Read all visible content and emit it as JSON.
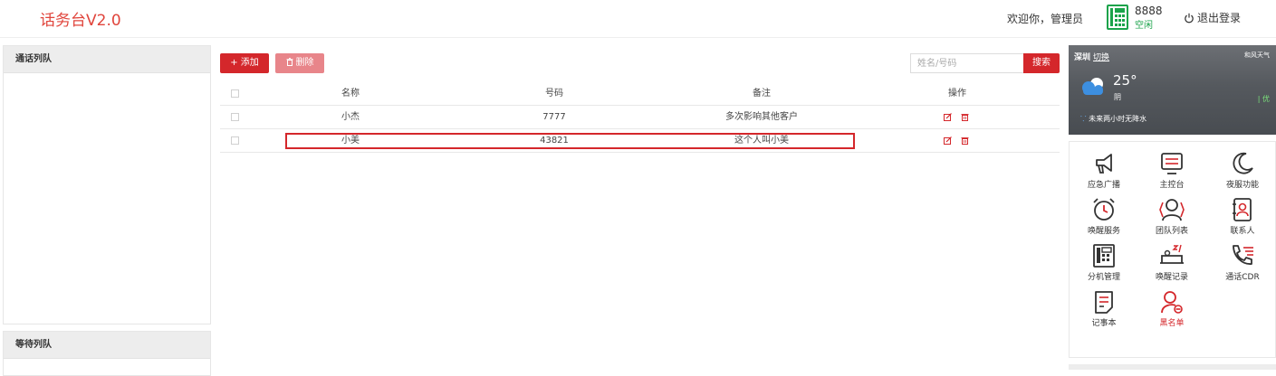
{
  "app": {
    "title": "话务台V2.0"
  },
  "header": {
    "welcome": "欢迎你，管理员",
    "extension": "8888",
    "extension_status": "空闲",
    "logout": "退出登录"
  },
  "left": {
    "call_queue_title": "通话列队",
    "wait_queue_title": "等待列队"
  },
  "toolbar": {
    "add_label": "+ 添加",
    "delete_label": "删除",
    "search_placeholder": "姓名/号码",
    "search_label": "搜索"
  },
  "table": {
    "columns": [
      "名称",
      "号码",
      "备注",
      "操作"
    ],
    "rows": [
      {
        "name": "小杰",
        "number": "7777",
        "note": "多次影响其他客户"
      },
      {
        "name": "小美",
        "number": "43821",
        "note": "这个人叫小美"
      }
    ]
  },
  "weather": {
    "city": "深圳",
    "switch": "切换",
    "provider": "和风天气",
    "temp": "25°",
    "condition": "阴",
    "aqi": "| 优",
    "forecast": "未来两小时无降水"
  },
  "shortcuts": [
    {
      "label": "应急广播",
      "icon": "megaphone-icon"
    },
    {
      "label": "主控台",
      "icon": "console-icon"
    },
    {
      "label": "夜服功能",
      "icon": "moon-icon"
    },
    {
      "label": "唤醒服务",
      "icon": "alarm-clock-icon"
    },
    {
      "label": "团队列表",
      "icon": "team-icon"
    },
    {
      "label": "联系人",
      "icon": "contact-book-icon"
    },
    {
      "label": "分机管理",
      "icon": "desk-phone-icon"
    },
    {
      "label": "唤醒记录",
      "icon": "wake-record-icon"
    },
    {
      "label": "通话CDR",
      "icon": "phone-list-icon"
    },
    {
      "label": "记事本",
      "icon": "notepad-icon"
    },
    {
      "label": "黑名单",
      "icon": "blacklist-user-icon"
    }
  ],
  "colors": {
    "accent": "#d4272b",
    "brand": "#e0443b",
    "status_idle": "#1aa34a"
  }
}
